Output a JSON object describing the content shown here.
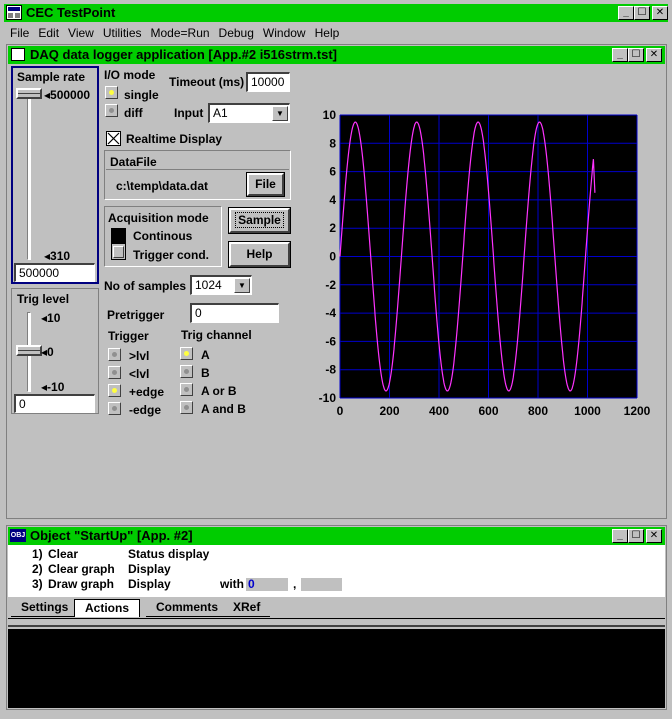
{
  "app": {
    "title": "CEC TestPoint"
  },
  "menu": [
    "File",
    "Edit",
    "View",
    "Utilities",
    "Mode=Run",
    "Debug",
    "Window",
    "Help"
  ],
  "panel": {
    "title": "DAQ data logger application [App.#2 i516strm.tst]",
    "sample_rate": {
      "label": "Sample rate",
      "max_label": "500000",
      "min_label": "310",
      "value": "500000",
      "level": 1.0
    },
    "trig_level": {
      "label": "Trig level",
      "max_label": "10",
      "mid_label": "0",
      "min_label": "-10",
      "value": "0",
      "level": 0.5
    },
    "io_mode": {
      "label": "I/O mode",
      "options": [
        "single",
        "diff"
      ],
      "selected": "single"
    },
    "timeout": {
      "label": "Timeout (ms)",
      "value": "10000"
    },
    "input": {
      "label": "Input",
      "value": "A1"
    },
    "realtime": {
      "label": "Realtime Display",
      "checked": true
    },
    "datafile": {
      "label": "DataFile",
      "path": "c:\\temp\\data.dat",
      "button": "File"
    },
    "acq_mode": {
      "label": "Acquisition mode",
      "options": [
        "Continous",
        "Trigger cond."
      ],
      "selected": "Continous"
    },
    "sample_button": "Sample",
    "help_button": "Help",
    "samples": {
      "label": "No of samples",
      "value": "1024"
    },
    "pretrigger": {
      "label": "Pretrigger",
      "value": "0"
    },
    "trigger": {
      "label": "Trigger",
      "options": [
        ">lvl",
        "<lvl",
        "+edge",
        "-edge"
      ],
      "selected": "+edge"
    },
    "trig_channel": {
      "label": "Trig channel",
      "options": [
        "A",
        "B",
        "A or B",
        "A and B"
      ],
      "selected": "A"
    }
  },
  "chart_data": {
    "type": "line",
    "xlim": [
      0,
      1200
    ],
    "ylim": [
      -10,
      10
    ],
    "xticks": [
      "0",
      "200",
      "400",
      "600",
      "800",
      "1000",
      "1200"
    ],
    "yticks": [
      "10",
      "8",
      "6",
      "4",
      "2",
      "0",
      "-2",
      "-4",
      "-6",
      "-8",
      "-10"
    ],
    "grid": true,
    "colors": {
      "background": "#000000",
      "grid": "#0000cc",
      "line": "#ff33ff"
    },
    "series": [
      {
        "x_start": 0,
        "x_end": 1024,
        "amplitude": 9.5,
        "period": 248,
        "phase_peak_x": 62,
        "final_y": 4.5
      }
    ]
  },
  "object_window": {
    "title": "Object \"StartUp\" [App. #2]",
    "rows": [
      {
        "num": "1)",
        "action": "Clear",
        "target": "Status display"
      },
      {
        "num": "2)",
        "action": "Clear graph",
        "target": "Display"
      },
      {
        "num": "3)",
        "action": "Draw graph",
        "target": "Display",
        "with_label": "with",
        "with_value": "0",
        "sep": ","
      }
    ],
    "tabs": [
      "Settings",
      "Actions",
      "Comments",
      "XRef"
    ],
    "active_tab": "Actions"
  }
}
